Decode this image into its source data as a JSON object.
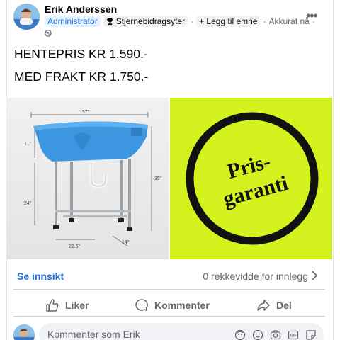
{
  "author": {
    "name": "Erik Anderssen",
    "role_badge": "Administrator",
    "contributor_badge": "Stjernebidragsyter",
    "add_topic": "+ Legg til emne",
    "dot": "·",
    "timestamp": "Akkurat nå",
    "dot2": "·"
  },
  "post": {
    "line1": "HENTEPRIS KR 1.590.-",
    "line2": "MED FRAKT KR 1.750.-"
  },
  "product_image": {
    "dim_width": "37\"",
    "dim_height_tub": "11\"",
    "dim_height_total": "35\"",
    "dim_leg": "24\"",
    "dim_depth": "22.5\"",
    "dim_side": "14\"",
    "tub_color": "#3d96e0"
  },
  "promo_image": {
    "line1": "Pris-",
    "line2": "garanti",
    "bg_color": "#d4f21e"
  },
  "insight": {
    "link": "Se innsikt",
    "reach": "0 rekkevidde for innlegg"
  },
  "actions": {
    "like": "Liker",
    "comment": "Kommenter",
    "share": "Del"
  },
  "comment_box": {
    "placeholder": "Kommenter som Erik"
  },
  "colors": {
    "accent": "#216fdb",
    "muted": "#65676b"
  }
}
